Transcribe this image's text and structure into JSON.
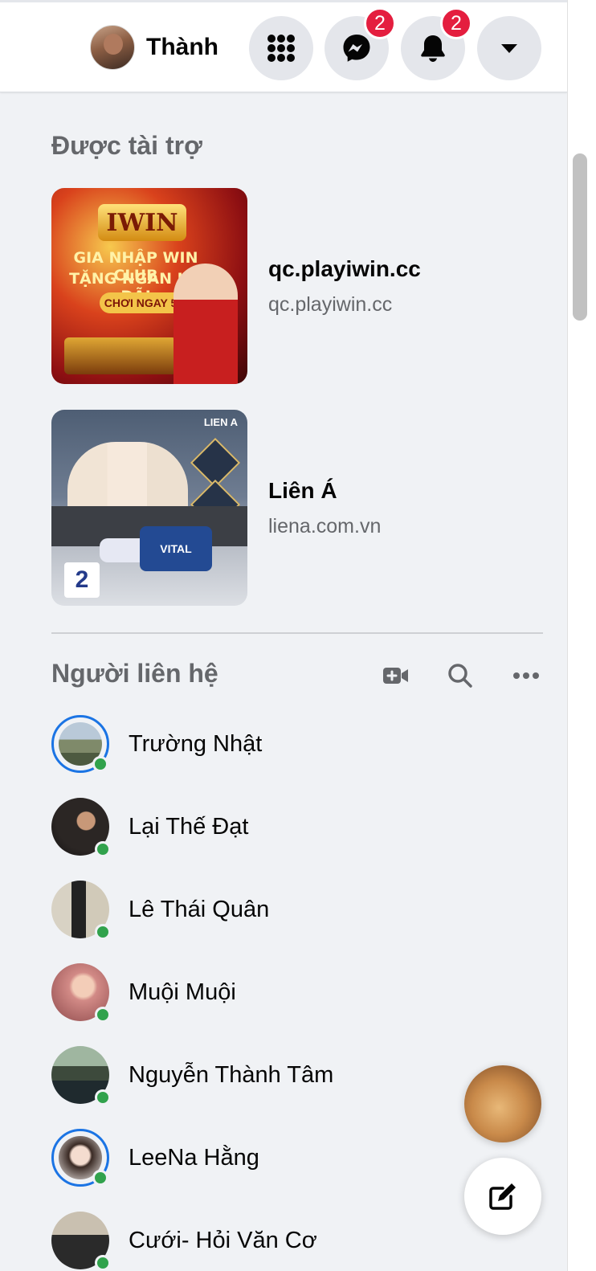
{
  "header": {
    "profile_name": "Thành",
    "menu_icon": "grid-menu-icon",
    "messenger_icon": "messenger-icon",
    "messenger_badge": "2",
    "notifications_icon": "bell-icon",
    "notifications_badge": "2",
    "account_icon": "caret-down-icon",
    "badge_color": "#e41e3f"
  },
  "sponsored": {
    "title": "Được tài trợ",
    "ads": [
      {
        "title": "qc.playiwin.cc",
        "url": "qc.playiwin.cc",
        "image_text": {
          "logo": "IWIN",
          "line1": "GIA NHẬP WIN CLUB",
          "line2": "TẶNG NGÀN ƯU ĐÃI",
          "cta": "CHƠI NGAY 50K"
        }
      },
      {
        "title": "Liên Á",
        "url": "liena.com.vn",
        "image_text": {
          "brand": "LIEN A",
          "product": "VITAL",
          "price": "2"
        }
      }
    ]
  },
  "contacts": {
    "title": "Người liên hệ",
    "tools": [
      "video-call-add-icon",
      "search-icon",
      "more-options-icon"
    ],
    "online_color": "#31a24c",
    "story_ring_color": "#1b74e4",
    "items": [
      {
        "name": "Trường Nhật",
        "story": true
      },
      {
        "name": "Lại Thế Đạt",
        "story": false
      },
      {
        "name": "Lê Thái Quân",
        "story": false
      },
      {
        "name": "Muội Muội",
        "story": false
      },
      {
        "name": "Nguyễn Thành Tâm",
        "story": false
      },
      {
        "name": "LeeNa Hằng",
        "story": true
      },
      {
        "name": "Cưới- Hỏi Văn Cơ",
        "story": false
      }
    ]
  },
  "floating": {
    "chat_head": "chat-head-avatar",
    "compose_icon": "compose-message-icon"
  }
}
